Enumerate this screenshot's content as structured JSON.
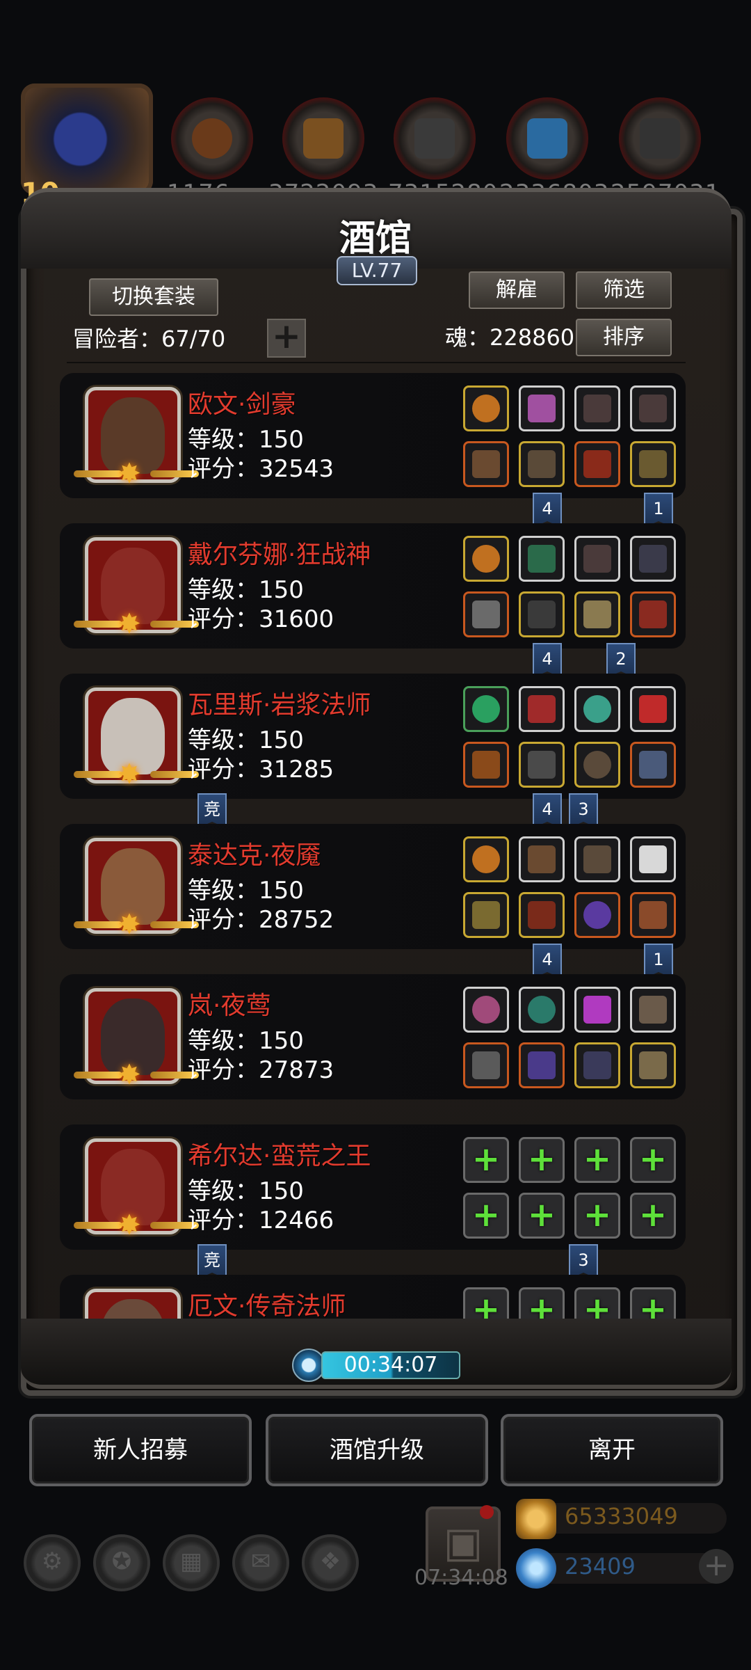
{
  "top_bar": {
    "level_badge": "10",
    "resources": [
      "1176",
      "3722093",
      "7315280",
      "2336803",
      "2597031"
    ]
  },
  "panel": {
    "title": "酒馆",
    "level": "LV.77",
    "switch_outfit_label": "切换套装",
    "dismiss_label": "解雇",
    "filter_label": "筛选",
    "sort_label": "排序",
    "adventurers_text": "冒险者：67/70",
    "soul_text": "魂：228860"
  },
  "heroes": [
    {
      "name": "欧文·剑豪",
      "level": "等级：150",
      "score": "评分：32543",
      "tags": [
        {
          "text": "4",
          "slot": 1
        },
        {
          "text": "1",
          "slot": 3
        }
      ]
    },
    {
      "name": "戴尔芬娜·狂战神",
      "level": "等级：150",
      "score": "评分：31600",
      "tags": [
        {
          "text": "4",
          "slot": 1
        },
        {
          "text": "2",
          "slot": 2
        }
      ]
    },
    {
      "name": "瓦里斯·岩浆法师",
      "level": "等级：150",
      "score": "评分：31285",
      "tags": [
        {
          "text": "竞",
          "slot": -1
        },
        {
          "text": "4",
          "slot": 1
        },
        {
          "text": "3",
          "slot": 2
        }
      ]
    },
    {
      "name": "泰达克·夜魇",
      "level": "等级：150",
      "score": "评分：28752",
      "tags": [
        {
          "text": "4",
          "slot": 1
        },
        {
          "text": "1",
          "slot": 3
        }
      ]
    },
    {
      "name": "岚·夜莺",
      "level": "等级：150",
      "score": "评分：27873",
      "tags": []
    },
    {
      "name": "希尔达·蛮荒之王",
      "level": "等级：150",
      "score": "评分：12466",
      "tags": [
        {
          "text": "竞",
          "slot": -1
        },
        {
          "text": "3",
          "slot": 2
        }
      ]
    },
    {
      "name": "厄文·传奇法师",
      "level": "",
      "score": "",
      "tags": []
    }
  ],
  "timer": "00:34:07",
  "actions": {
    "recruit_label": "新人招募",
    "upgrade_label": "酒馆升级",
    "leave_label": "离开"
  },
  "bottom": {
    "gift_timer": "07:34:08",
    "gold": "65333049",
    "gems": "23409"
  }
}
